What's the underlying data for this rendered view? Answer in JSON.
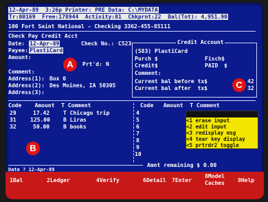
{
  "status": {
    "line1": "12-Apr-89  3:26p Printer: PRE Data: C:\\MYDATA",
    "line2": "Tr:00169  Free:178944  Activity:81  Chkprnt:22  Bal(Tot): 4,951.90"
  },
  "account_title": "100 Fort Saint National - Checking 3362-455-85111",
  "form_title": "Check Pay Credit Acct",
  "fields": {
    "date_label": "Date:",
    "date_value": "12-Apr-89",
    "checkno_label": "Check No.:",
    "checkno_value": "C523",
    "payee_label": "Payee:",
    "payee_value": "PlastiCard",
    "amount_label": "Amount:",
    "printed_label": "Prt'd:",
    "printed_value": "N",
    "comment_label": "Comment:",
    "address1_label": "Address(1):",
    "address1_value": "Box 0",
    "address2_label": "Address(2):",
    "address2_value": "Des Moines, IA 50305",
    "address3_label": "Address(3):"
  },
  "credit": {
    "title": "Credit Account",
    "name": "(583) PlastiCard",
    "purch_label": "Purch $",
    "purch_value": "Fisch$",
    "credit_label": "Credit$",
    "credit_value": "PAID",
    "credit_suffix": "$",
    "comment_label": "Comment:",
    "before_label": "Current bal before tx$",
    "before_value": "42",
    "after_label": "Current bal after  tx$",
    "after_value": "32"
  },
  "split": {
    "header_left": "Code    Amount  T Comment",
    "header_right": "Code   Amount  T Comment",
    "rows": [
      {
        "code": "29",
        "amount": "17.42",
        "comment": "T Chicago trip"
      },
      {
        "code": "31",
        "amount": "125.00",
        "comment": "B Liras"
      },
      {
        "code": "32",
        "amount": "50.00",
        "comment": "B books"
      }
    ],
    "markers": [
      "4",
      "5",
      "6",
      "7",
      "8",
      "9",
      "10"
    ],
    "remaining": "Amnt remaining $ 0.00"
  },
  "help": {
    "title": "         ",
    "items": [
      {
        "key": "<1",
        "text": "erase input"
      },
      {
        "key": "<2",
        "text": "edit input"
      },
      {
        "key": "<3",
        "text": "redisplay msg"
      },
      {
        "key": "<4",
        "text": "tear key display"
      },
      {
        "key": "<5",
        "text": "prtrdr2 toggle"
      }
    ]
  },
  "footer": {
    "date": "Date ? 12-Apr-89"
  },
  "function_keys": [
    {
      "num": "1",
      "label": "Bal"
    },
    {
      "num": "2",
      "label": "Ledger"
    },
    {
      "num": "4",
      "label": "Verify"
    },
    {
      "num": "6",
      "label": "Detail"
    },
    {
      "num": "7",
      "label": "Enter"
    },
    {
      "num": "8",
      "label": "Model Caches"
    },
    {
      "num": "9",
      "label": "Help"
    }
  ],
  "callouts": [
    "A",
    "B",
    "C"
  ],
  "colors": {
    "screen": "#0b1a8c",
    "highlight": "#e8e8e8",
    "callout": "#e01414",
    "help": "#f2e600",
    "fkbar": "#c81818"
  }
}
